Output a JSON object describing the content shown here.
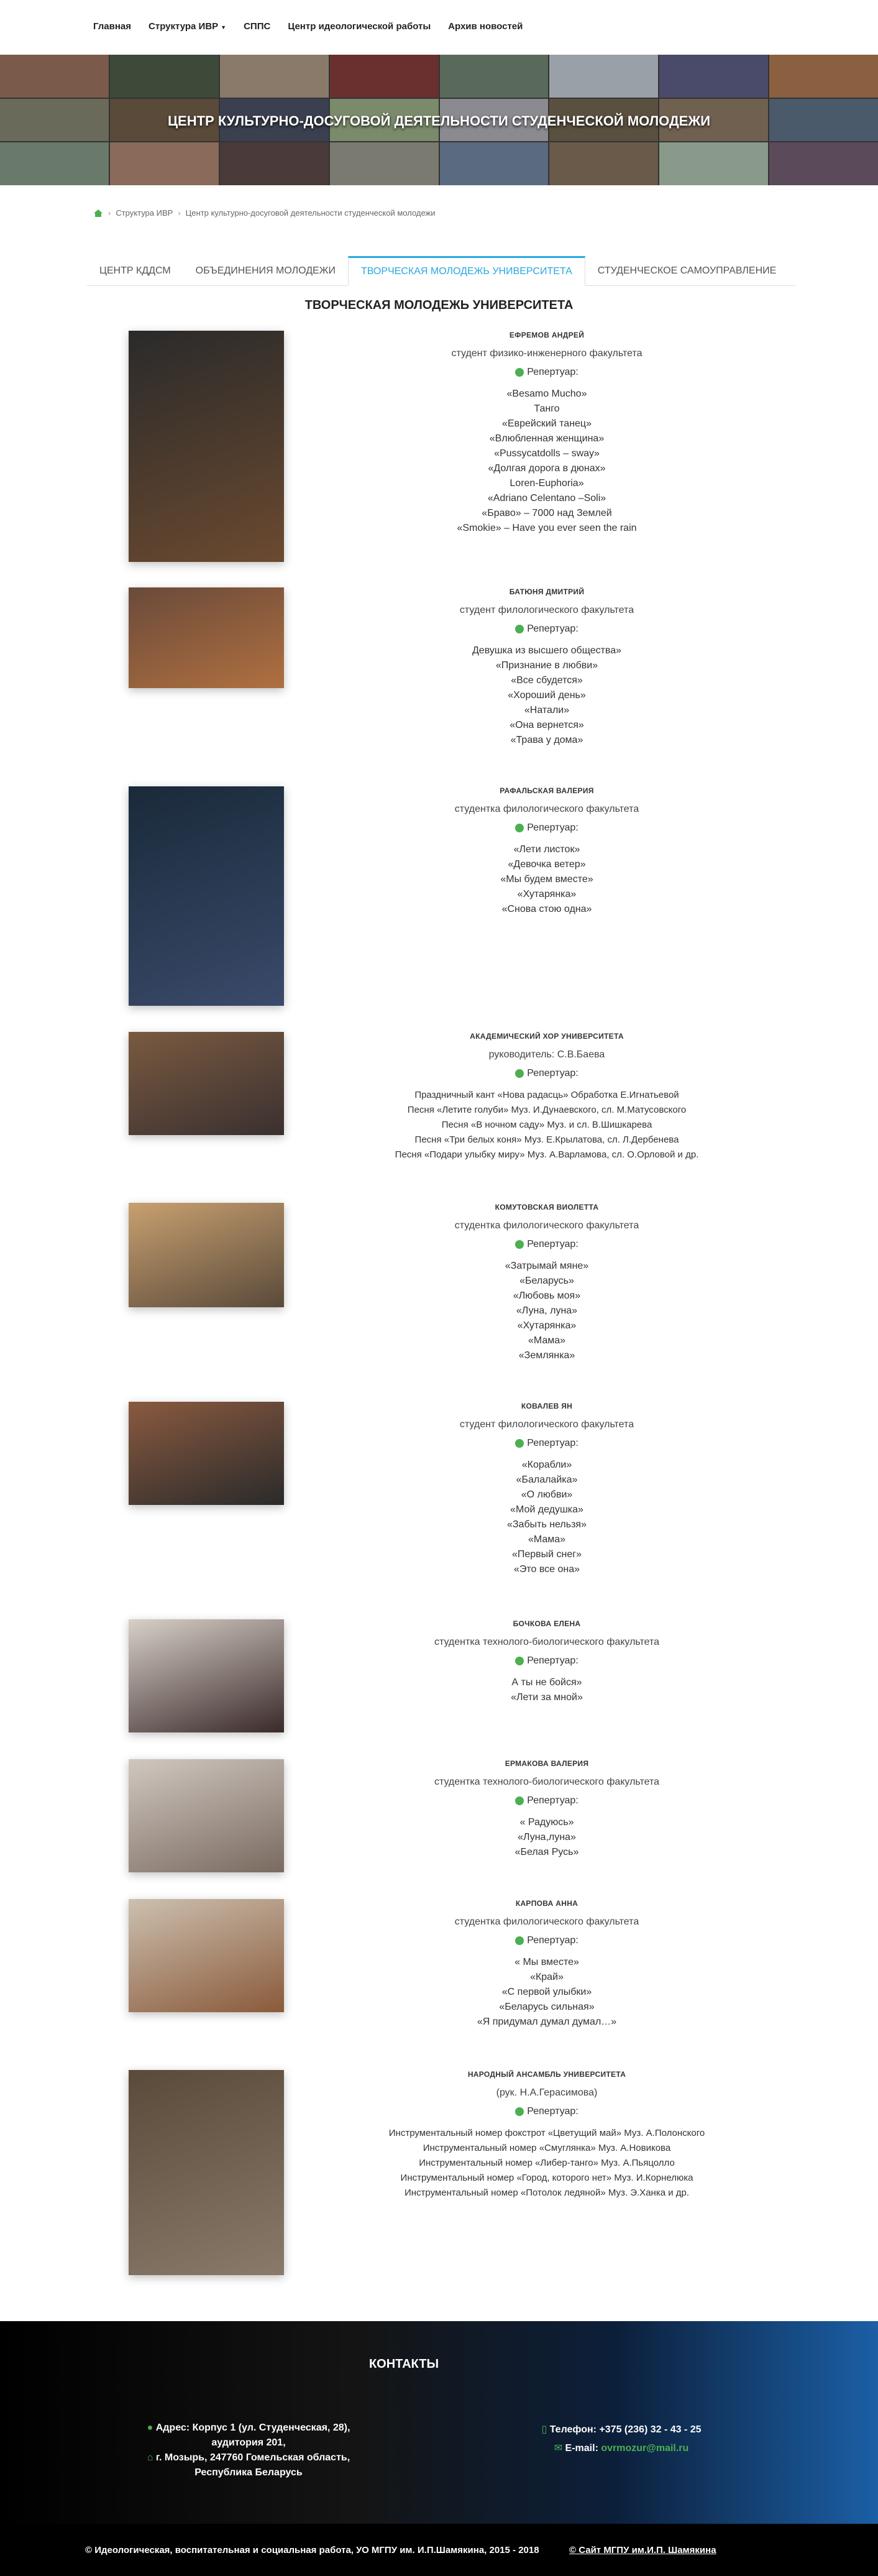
{
  "nav": {
    "items": [
      "Главная",
      "Структура ИВР",
      "СППС",
      "Центр идеологической работы",
      "Архив новостей"
    ]
  },
  "banner": {
    "title": "ЦЕНТР КУЛЬТУРНО-ДОСУГОВОЙ ДЕЯТЕЛЬНОСТИ СТУДЕНЧЕСКОЙ МОЛОДЕЖИ"
  },
  "breadcrumb": {
    "level1": "Структура ИВР",
    "level2": "Центр культурно-досуговой деятельности студенческой молодежи"
  },
  "tabs": [
    "ЦЕНТР КДДСМ",
    "ОБЪЕДИНЕНИЯ МОЛОДЕЖИ",
    "ТВОРЧЕСКАЯ МОЛОДЕЖЬ УНИВЕРСИТЕТА",
    "СТУДЕНЧЕСКОЕ САМОУПРАВЛЕНИЕ"
  ],
  "section_title": "ТВОРЧЕСКАЯ МОЛОДЕЖЬ УНИВЕРСИТЕТА",
  "repertoire_label": "Репертуар:",
  "performers": [
    {
      "name": "ЕФРЕМОВ АНДРЕЙ",
      "sub": "студент физико-инженерного факультета",
      "songs": [
        "«Besamo Mucho»",
        "Танго",
        "«Еврейский танец»",
        "«Влюбленная женщина»",
        "«Pussycatdolls – sway»",
        "«Долгая дорога в дюнах»",
        "Loren-Euphoria»",
        "«Adriano Celentano –Soli»",
        "«Браво» – 7000 над Землей",
        "«Smokie» – Have you ever seen the rain"
      ]
    },
    {
      "name": "БАТЮНЯ ДМИТРИЙ",
      "sub": "студент филологического факультета",
      "songs": [
        "Девушка из высшего общества»",
        "«Признание в любви»",
        "«Все сбудется»",
        "«Хороший день»",
        "«Натали»",
        "«Она вернется»",
        "«Трава у дома»"
      ]
    },
    {
      "name": "РАФАЛЬСКАЯ ВАЛЕРИЯ",
      "sub": "студентка филологического факультета",
      "songs": [
        "«Лети листок»",
        "«Девочка ветер»",
        "«Мы будем вместе»",
        "«Хутарянка»",
        "«Снова стою одна»"
      ]
    },
    {
      "name": "АКАДЕМИЧЕСКИЙ ХОР УНИВЕРСИТЕТА",
      "sub": "руководитель: С.В.Баева",
      "songs": [
        "Праздничный кант «Нова радасць» Обработка Е.Игнатьевой",
        "Песня «Летите голуби» Муз. И.Дунаевского, сл. М.Матусовского",
        "Песня «В ночном саду» Муз. и сл. В.Шишкарева",
        "Песня «Три белых коня» Муз. Е.Крылатова, сл. Л.Дербенева",
        "Песня «Подари улыбку миру» Муз. А.Варламова, сл. О.Орловой и др."
      ]
    },
    {
      "name": "КОМУТОВСКАЯ ВИОЛЕТТА",
      "sub": "студентка филологического факультета",
      "songs": [
        "«Затрымай мяне»",
        "«Беларусь»",
        "«Любовь моя»",
        "«Луна, луна»",
        "«Хутарянка»",
        "«Мама»",
        "«Землянка»"
      ]
    },
    {
      "name": "КОВАЛЕВ ЯН",
      "sub": "студент филологического факультета",
      "songs": [
        "«Корабли»",
        "«Балалайка»",
        "«О любви»",
        "«Мой дедушка»",
        "«Забыть нельзя»",
        "«Мама»",
        "«Первый снег»",
        "«Это все она»"
      ]
    },
    {
      "name": "БОЧКОВА ЕЛЕНА",
      "sub": "студентка технолого-биологического факультета",
      "songs": [
        "А ты не бойся»",
        "«Лети за мной»"
      ]
    },
    {
      "name": "ЕРМАКОВА ВАЛЕРИЯ",
      "sub": "студентка технолого-биологического факультета",
      "songs": [
        "« Радуюсь»",
        "«Луна,луна»",
        "«Белая Русь»"
      ]
    },
    {
      "name": "КАРПОВА АННА",
      "sub": "студентка филологического факультета",
      "songs": [
        "« Мы вместе»",
        "«Край»",
        "«С первой улыбки»",
        "«Беларусь сильная»",
        "«Я придумал думал думал…»"
      ]
    },
    {
      "name": "НАРОДНЫЙ АНСАМБЛЬ УНИВЕРСИТЕТА",
      "sub": "(рук. Н.А.Герасимова)",
      "songs": [
        "Инструментальный номер фокстрот «Цветущий май» Муз. А.Полонского",
        "Инструментальный номер «Смуглянка» Муз. А.Новикова",
        "Инструментальный номер «Либер-танго» Муз. А.Пьяцолло",
        "Инструментальный номер «Город, которого нет» Муз. И.Корнелюка",
        "Инструментальный номер «Потолок ледяной» Муз. Э.Ханка и др."
      ]
    }
  ],
  "footer": {
    "title": "КОНТАКТЫ",
    "address_line1": "Адрес: Корпус 1 (ул. Студенческая, 28),",
    "address_line2": "аудитория 201,",
    "address_line3": "г. Мозырь, 247760 Гомельская область,",
    "address_line4": "Республика Беларусь",
    "phone": "Телефон: +375 (236) 32 - 43 - 25",
    "email_label": "E-mail:",
    "email": "ovrmozur@mail.ru",
    "copyright": "© Идеологическая, воспитательная и социальная работа, УО МГПУ им. И.П.Шамякина, 2015 - 2018",
    "site_link": "© Сайт МГПУ им.И.П. Шамякина"
  },
  "colors": {
    "accent": "#27a9e1",
    "green": "#4caf50"
  }
}
